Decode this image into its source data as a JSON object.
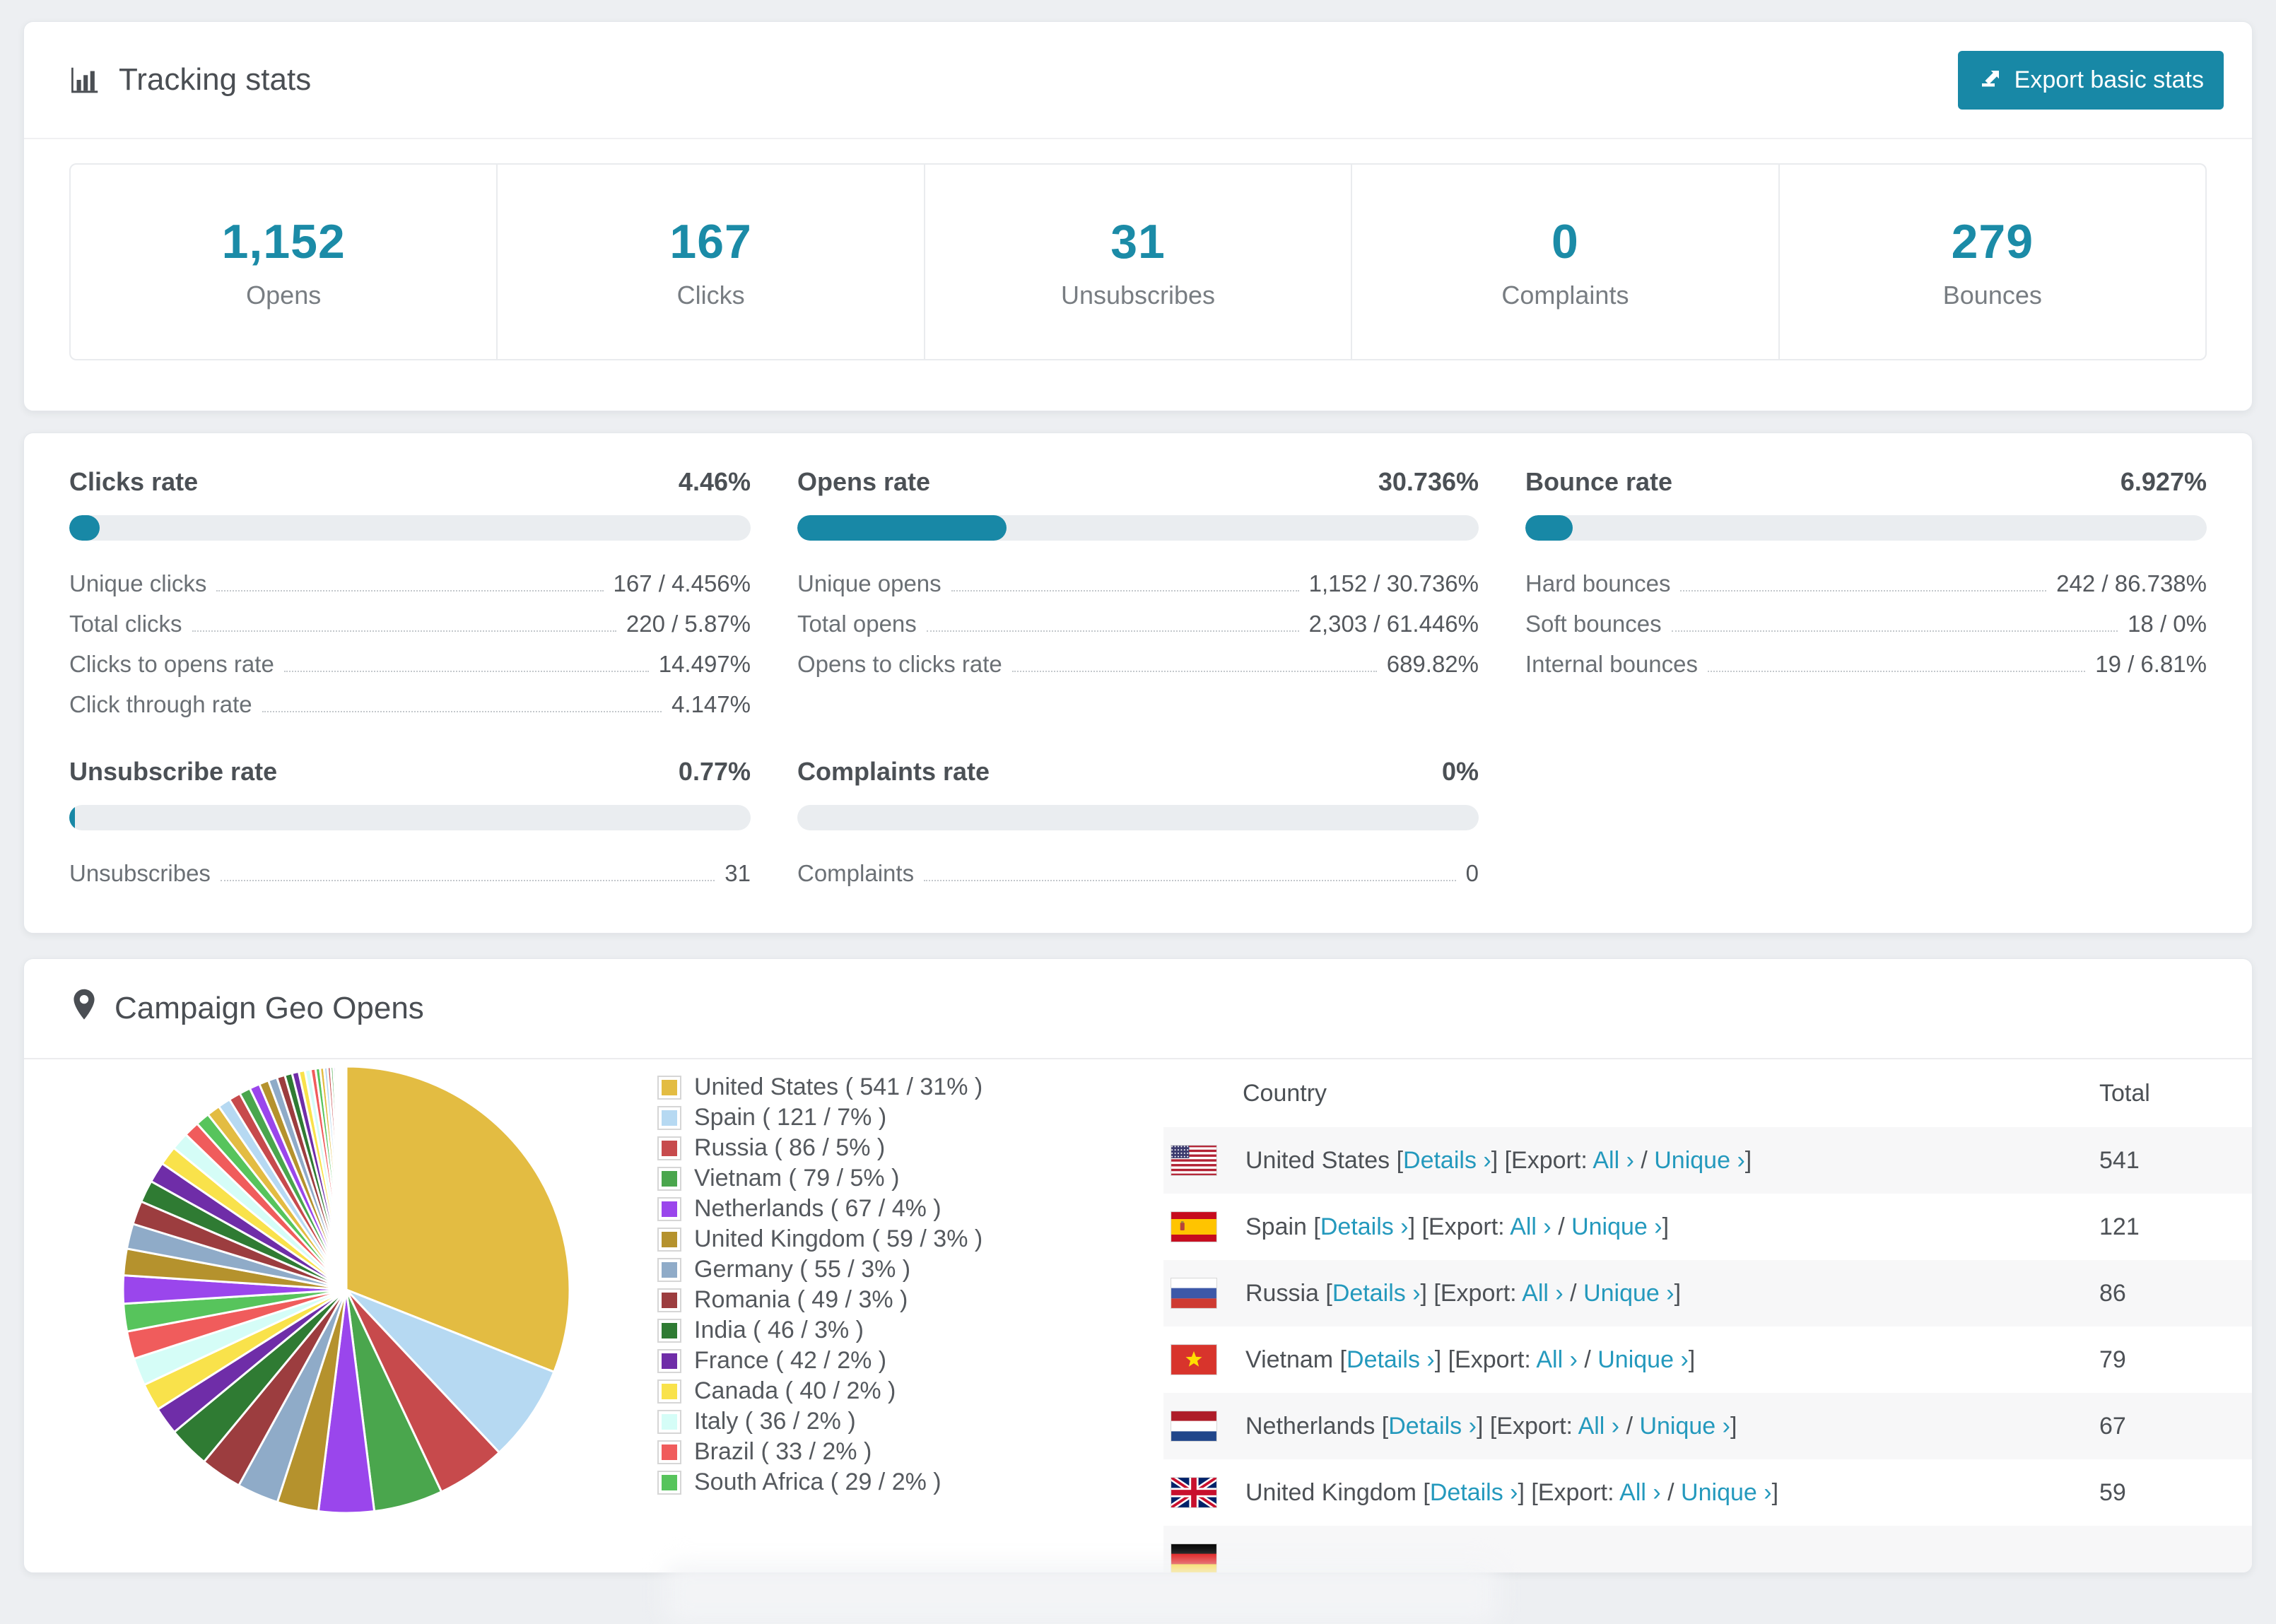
{
  "accent": "#1888A6",
  "link_color": "#2499BD",
  "tracking": {
    "title": "Tracking stats",
    "export_button": "Export basic stats",
    "stats": [
      {
        "value": "1,152",
        "label": "Opens"
      },
      {
        "value": "167",
        "label": "Clicks"
      },
      {
        "value": "31",
        "label": "Unsubscribes"
      },
      {
        "value": "0",
        "label": "Complaints"
      },
      {
        "value": "279",
        "label": "Bounces"
      }
    ]
  },
  "rates": {
    "blocks": [
      {
        "title": "Clicks rate",
        "value": "4.46%",
        "pct": 4.46,
        "rows": [
          {
            "label": "Unique clicks",
            "value": "167 / 4.456%"
          },
          {
            "label": "Total clicks",
            "value": "220 / 5.87%"
          },
          {
            "label": "Clicks to opens rate",
            "value": "14.497%"
          },
          {
            "label": "Click through rate",
            "value": "4.147%"
          }
        ]
      },
      {
        "title": "Opens rate",
        "value": "30.736%",
        "pct": 30.736,
        "rows": [
          {
            "label": "Unique opens",
            "value": "1,152 / 30.736%"
          },
          {
            "label": "Total opens",
            "value": "2,303 / 61.446%"
          },
          {
            "label": "Opens to clicks rate",
            "value": "689.82%"
          }
        ]
      },
      {
        "title": "Bounce rate",
        "value": "6.927%",
        "pct": 6.927,
        "rows": [
          {
            "label": "Hard bounces",
            "value": "242 / 86.738%"
          },
          {
            "label": "Soft bounces",
            "value": "18 / 0%"
          },
          {
            "label": "Internal bounces",
            "value": "19 / 6.81%"
          }
        ]
      },
      {
        "title": "Unsubscribe rate",
        "value": "0.77%",
        "pct": 0.77,
        "rows": [
          {
            "label": "Unsubscribes",
            "value": "31"
          }
        ]
      },
      {
        "title": "Complaints rate",
        "value": "0%",
        "pct": 0,
        "rows": [
          {
            "label": "Complaints",
            "value": "0"
          }
        ]
      }
    ]
  },
  "geo": {
    "title": "Campaign Geo Opens",
    "legend": [
      {
        "label": "United States ( 541 / 31% )",
        "color": "#E3BC42"
      },
      {
        "label": "Spain ( 121 / 7% )",
        "color": "#B6D9F2"
      },
      {
        "label": "Russia ( 86 / 5% )",
        "color": "#C74A4C"
      },
      {
        "label": "Vietnam ( 79 / 5% )",
        "color": "#4AA64D"
      },
      {
        "label": "Netherlands ( 67 / 4% )",
        "color": "#9A46EC"
      },
      {
        "label": "United Kingdom ( 59 / 3% )",
        "color": "#B5922D"
      },
      {
        "label": "Germany ( 55 / 3% )",
        "color": "#8FABC8"
      },
      {
        "label": "Romania ( 49 / 3% )",
        "color": "#9C3D3F"
      },
      {
        "label": "India ( 46 / 3% )",
        "color": "#2F7B33"
      },
      {
        "label": "France ( 42 / 2% )",
        "color": "#6F2DA8"
      },
      {
        "label": "Canada ( 40 / 2% )",
        "color": "#F9E24B"
      },
      {
        "label": "Italy ( 36 / 2% )",
        "color": "#D5FDF7"
      },
      {
        "label": "Brazil ( 33 / 2% )",
        "color": "#F05C5C"
      },
      {
        "label": "South Africa ( 29 / 2% )",
        "color": "#57C45C"
      }
    ],
    "table": {
      "headers": {
        "country": "Country",
        "total": "Total"
      },
      "labels": {
        "open": " [",
        "details": "Details ›",
        "close": "] ",
        "export": "[Export: ",
        "all": "All ›",
        "slash": " / ",
        "unique": "Unique ›",
        "end": "]"
      },
      "rows": [
        {
          "flag": "us",
          "name": "United States",
          "total": "541",
          "partial": false
        },
        {
          "flag": "es",
          "name": "Spain",
          "total": "121",
          "partial": false
        },
        {
          "flag": "ru",
          "name": "Russia",
          "total": "86",
          "partial": false
        },
        {
          "flag": "vn",
          "name": "Vietnam",
          "total": "79",
          "partial": false
        },
        {
          "flag": "nl",
          "name": "Netherlands",
          "total": "67",
          "partial": false
        },
        {
          "flag": "gb",
          "name": "United Kingdom",
          "total": "59",
          "partial": false
        },
        {
          "flag": "de",
          "name": "",
          "total": "",
          "partial": true
        }
      ]
    }
  },
  "chart_data": {
    "type": "pie",
    "title": "Campaign Geo Opens",
    "legend_position": "right",
    "start_angle_deg": -90,
    "direction": "clockwise",
    "slices": [
      {
        "label": "United States",
        "value": 541,
        "pct": 31,
        "color": "#E3BC42"
      },
      {
        "label": "Spain",
        "value": 121,
        "pct": 7,
        "color": "#B6D9F2"
      },
      {
        "label": "Russia",
        "value": 86,
        "pct": 5,
        "color": "#C74A4C"
      },
      {
        "label": "Vietnam",
        "value": 79,
        "pct": 5,
        "color": "#4AA64D"
      },
      {
        "label": "Netherlands",
        "value": 67,
        "pct": 4,
        "color": "#9A46EC"
      },
      {
        "label": "United Kingdom",
        "value": 59,
        "pct": 3,
        "color": "#B5922D"
      },
      {
        "label": "Germany",
        "value": 55,
        "pct": 3,
        "color": "#8FABC8"
      },
      {
        "label": "Romania",
        "value": 49,
        "pct": 3,
        "color": "#9C3D3F"
      },
      {
        "label": "India",
        "value": 46,
        "pct": 3,
        "color": "#2F7B33"
      },
      {
        "label": "France",
        "value": 42,
        "pct": 2,
        "color": "#6F2DA8"
      },
      {
        "label": "Canada",
        "value": 40,
        "pct": 2,
        "color": "#F9E24B"
      },
      {
        "label": "Italy",
        "value": 36,
        "pct": 2,
        "color": "#D5FDF7"
      },
      {
        "label": "Brazil",
        "value": 33,
        "pct": 2,
        "color": "#F05C5C"
      },
      {
        "label": "South Africa",
        "value": 29,
        "pct": 2,
        "color": "#57C45C"
      }
    ],
    "other_slices_pct": 26,
    "other_tail_weights": [
      1.9,
      1.8,
      1.7,
      1.6,
      1.5,
      1.4,
      1.3,
      1.2,
      1.05,
      0.95,
      0.9,
      0.85,
      0.8,
      0.75,
      0.7,
      0.65,
      0.6,
      0.55,
      0.5,
      0.46,
      0.42,
      0.38,
      0.34,
      0.3,
      0.27,
      0.24,
      0.21,
      0.18,
      0.15,
      0.13,
      0.11,
      0.09,
      0.08,
      0.07,
      0.06,
      0.05,
      0.04,
      0.035,
      0.03,
      0.025
    ]
  }
}
